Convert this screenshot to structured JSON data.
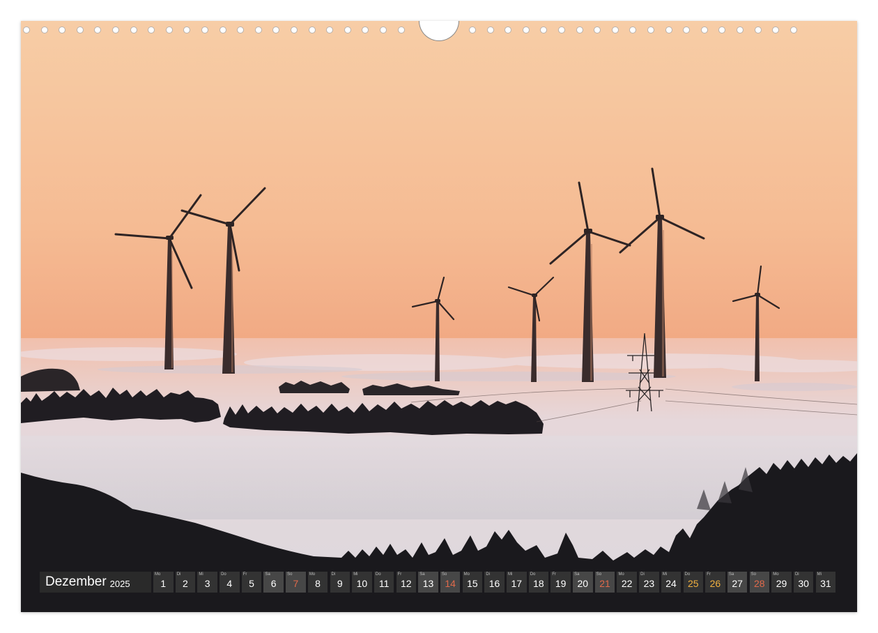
{
  "calendar": {
    "month": "Dezember",
    "year": "2025",
    "days": [
      {
        "wd": "Mo",
        "n": "1",
        "type": "normal"
      },
      {
        "wd": "Di",
        "n": "2",
        "type": "normal"
      },
      {
        "wd": "Mi",
        "n": "3",
        "type": "normal"
      },
      {
        "wd": "Do",
        "n": "4",
        "type": "normal"
      },
      {
        "wd": "Fr",
        "n": "5",
        "type": "normal"
      },
      {
        "wd": "Sa",
        "n": "6",
        "type": "sat"
      },
      {
        "wd": "So",
        "n": "7",
        "type": "sun"
      },
      {
        "wd": "Mo",
        "n": "8",
        "type": "normal"
      },
      {
        "wd": "Di",
        "n": "9",
        "type": "normal"
      },
      {
        "wd": "Mi",
        "n": "10",
        "type": "normal"
      },
      {
        "wd": "Do",
        "n": "11",
        "type": "normal"
      },
      {
        "wd": "Fr",
        "n": "12",
        "type": "normal"
      },
      {
        "wd": "Sa",
        "n": "13",
        "type": "sat"
      },
      {
        "wd": "So",
        "n": "14",
        "type": "sun"
      },
      {
        "wd": "Mo",
        "n": "15",
        "type": "normal"
      },
      {
        "wd": "Di",
        "n": "16",
        "type": "normal"
      },
      {
        "wd": "Mi",
        "n": "17",
        "type": "normal"
      },
      {
        "wd": "Do",
        "n": "18",
        "type": "normal"
      },
      {
        "wd": "Fr",
        "n": "19",
        "type": "normal"
      },
      {
        "wd": "Sa",
        "n": "20",
        "type": "sat"
      },
      {
        "wd": "So",
        "n": "21",
        "type": "sun"
      },
      {
        "wd": "Mo",
        "n": "22",
        "type": "normal"
      },
      {
        "wd": "Di",
        "n": "23",
        "type": "normal"
      },
      {
        "wd": "Mi",
        "n": "24",
        "type": "normal"
      },
      {
        "wd": "Do",
        "n": "25",
        "type": "holiday"
      },
      {
        "wd": "Fr",
        "n": "26",
        "type": "holiday"
      },
      {
        "wd": "Sa",
        "n": "27",
        "type": "sat"
      },
      {
        "wd": "So",
        "n": "28",
        "type": "sun"
      },
      {
        "wd": "Mo",
        "n": "29",
        "type": "normal"
      },
      {
        "wd": "Di",
        "n": "30",
        "type": "normal"
      },
      {
        "wd": "Mi",
        "n": "31",
        "type": "normal"
      }
    ]
  },
  "colors": {
    "sky_top": "#f6c9a0",
    "sky_bottom": "#f0a57e",
    "fog": "#e7dcdc",
    "forest": "#1c1b1f",
    "sunday_red": "#e06a4b",
    "holiday_gold": "#f0b040"
  }
}
